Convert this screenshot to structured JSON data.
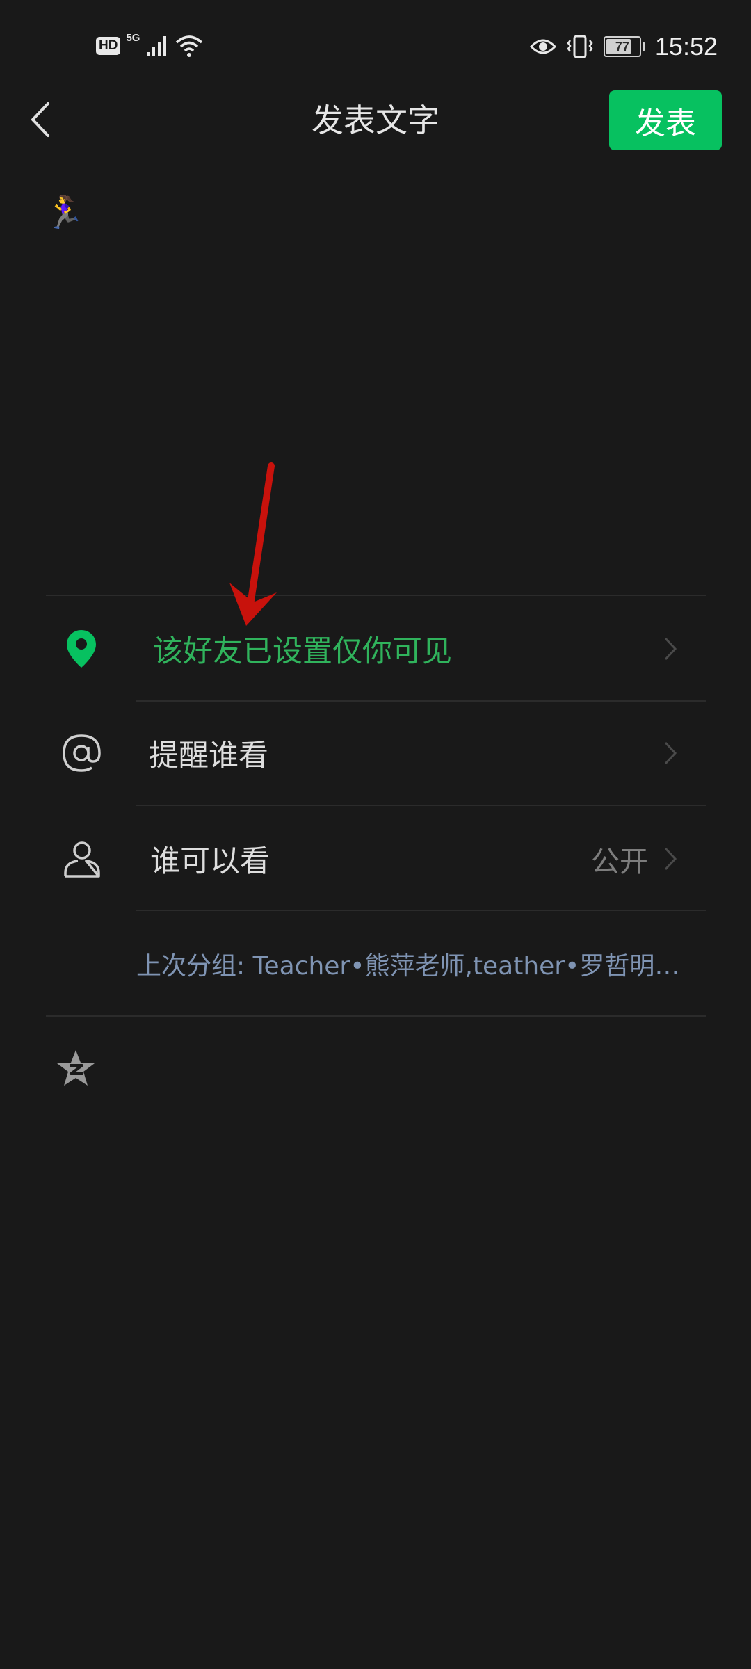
{
  "status_bar": {
    "hd": "HD",
    "network": "5G",
    "battery_level": "77",
    "time": "15:52"
  },
  "nav": {
    "title": "发表文字",
    "publish_label": "发表"
  },
  "post": {
    "content": "🏃‍♀️"
  },
  "options": {
    "location": {
      "label": "该好友已设置仅你可见",
      "icon": "location-pin-icon"
    },
    "remind": {
      "label": "提醒谁看",
      "icon": "at-icon"
    },
    "visibility": {
      "label": "谁可以看",
      "value": "公开",
      "icon": "person-icon"
    },
    "last_group": "上次分组: Teacher•熊萍老师,teather•罗哲明老..."
  },
  "colors": {
    "accent": "#07c160",
    "location_text": "#30b35c",
    "group_text": "#7f94b3",
    "background": "#191919",
    "annotation_arrow": "#c8120c"
  }
}
